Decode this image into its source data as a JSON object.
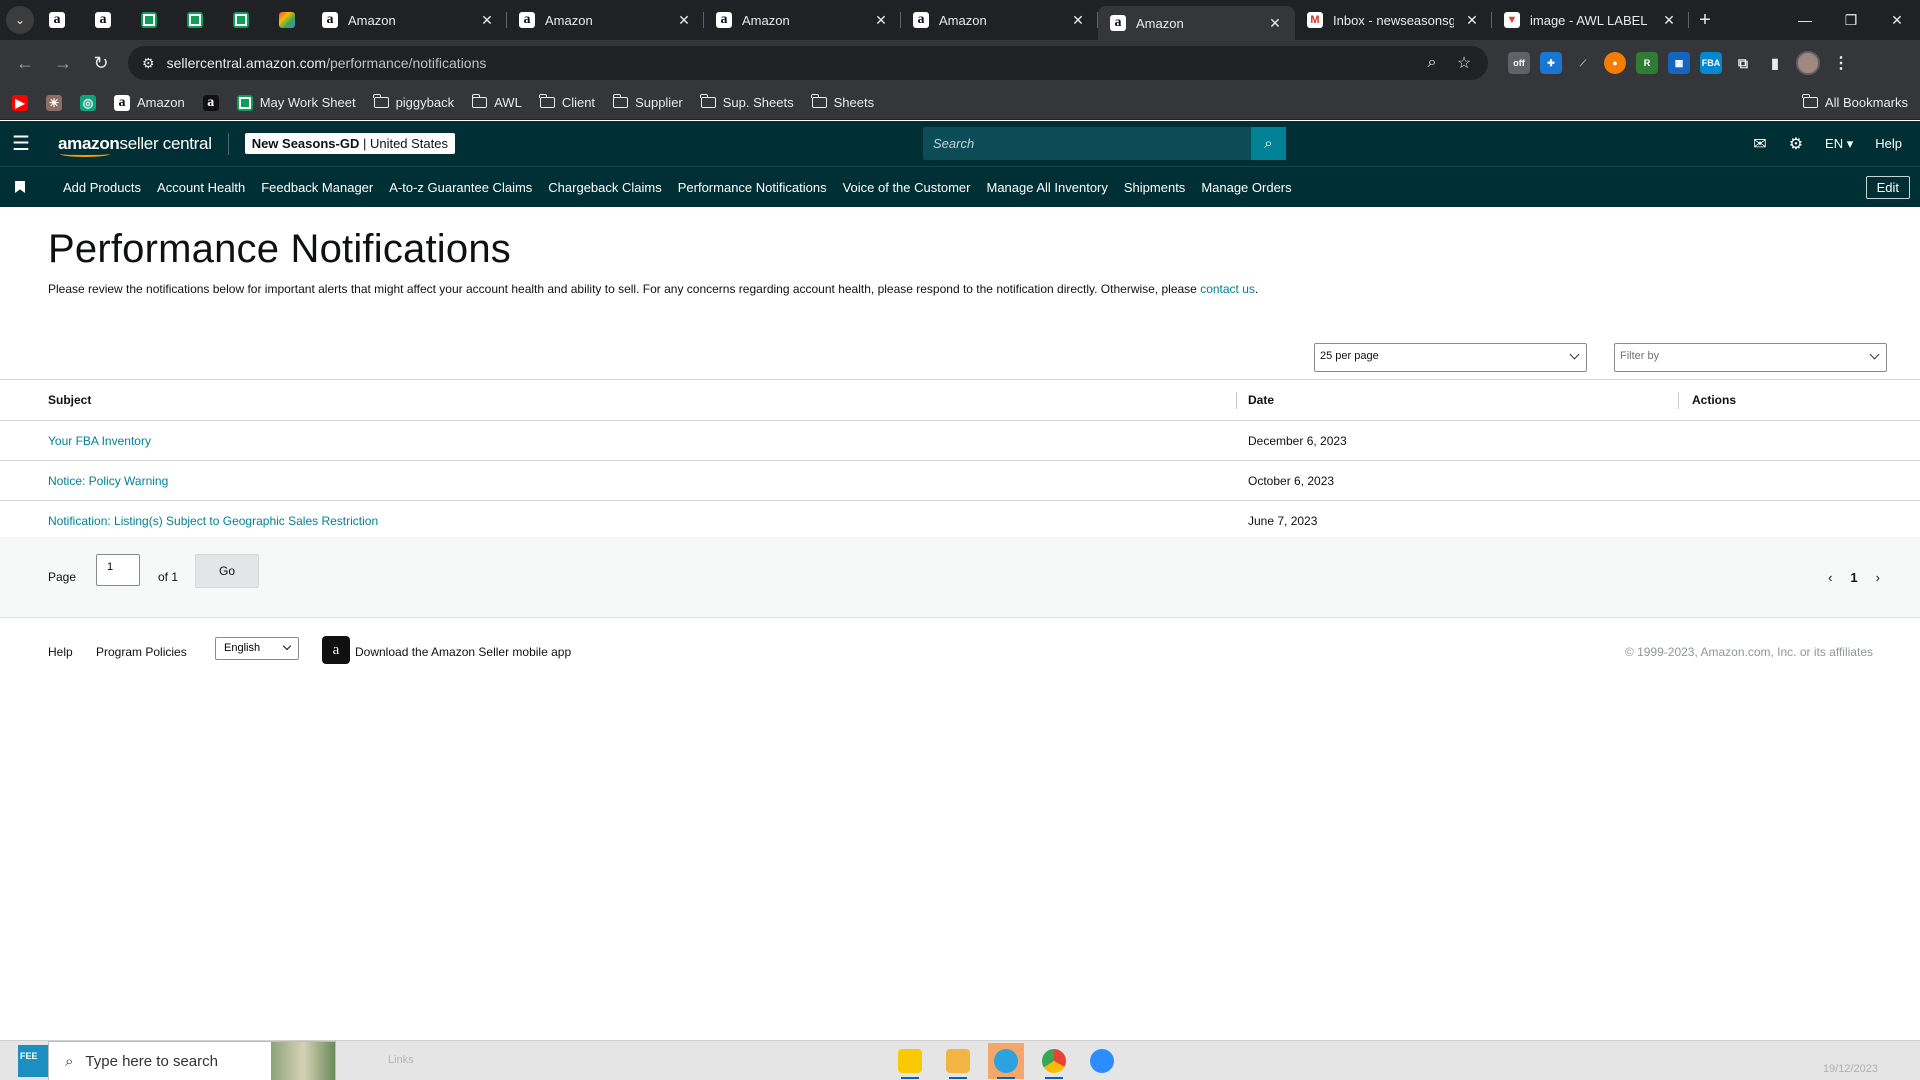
{
  "browser": {
    "tabs": [
      {
        "label": "Amazon",
        "icon": "amazon-icon"
      },
      {
        "label": "Amazon",
        "icon": "amazon-icon"
      },
      {
        "label": "Amazon",
        "icon": "amazon-icon"
      },
      {
        "label": "Amazon",
        "icon": "amazon-icon"
      },
      {
        "label": "Amazon",
        "icon": "amazon-icon",
        "active": true
      },
      {
        "label": "Inbox - newseasonsgd@",
        "icon": "gmail-icon"
      },
      {
        "label": "image - AWL LABEL",
        "icon": "image-icon"
      }
    ],
    "url_host": "sellercentral.amazon.com",
    "url_path": "/performance/notifications",
    "bookmarks": [
      "Amazon",
      "May Work Sheet",
      "piggyback",
      "AWL",
      "Client",
      "Supplier",
      "Sup. Sheets",
      "Sheets"
    ],
    "all_bookmarks": "All Bookmarks"
  },
  "header": {
    "logo_bold": "amazon",
    "logo_rest": " seller central",
    "store_name": "New Seasons-GD",
    "store_region": " | United States",
    "search_placeholder": "Search",
    "language": "EN",
    "help": "Help"
  },
  "nav": {
    "items": [
      "Add Products",
      "Account Health",
      "Feedback Manager",
      "A-to-z Guarantee Claims",
      "Chargeback Claims",
      "Performance Notifications",
      "Voice of the Customer",
      "Manage All Inventory",
      "Shipments",
      "Manage Orders"
    ],
    "edit": "Edit"
  },
  "page": {
    "title": "Performance Notifications",
    "intro": "Please review the notifications below for important alerts that might affect your account health and ability to sell. For any concerns regarding account health, please respond to the notification directly. Otherwise, please ",
    "intro_link": "contact us",
    "intro_end": ".",
    "per_page": "25 per page",
    "filter_placeholder": "Filter by"
  },
  "table": {
    "headers": {
      "subject": "Subject",
      "date": "Date",
      "actions": "Actions"
    },
    "rows": [
      {
        "subject": "Your FBA Inventory",
        "date": "December 6, 2023"
      },
      {
        "subject": "Notice: Policy Warning",
        "date": "October 6, 2023"
      },
      {
        "subject": "Notification: Listing(s) Subject to Geographic Sales Restriction",
        "date": "June 7, 2023"
      }
    ]
  },
  "pagination": {
    "page_label": "Page",
    "page_value": "1",
    "of_label": "of 1",
    "go": "Go",
    "current": "1"
  },
  "footer": {
    "help": "Help",
    "policies": "Program Policies",
    "language": "English",
    "app": "Download the Amazon Seller mobile app",
    "copyright": "© 1999-2023, Amazon.com, Inc. or its affiliates"
  },
  "taskbar": {
    "start_label": "FEE",
    "search_placeholder": "Type here to search",
    "links": "Links",
    "date": "19/12/2023"
  }
}
